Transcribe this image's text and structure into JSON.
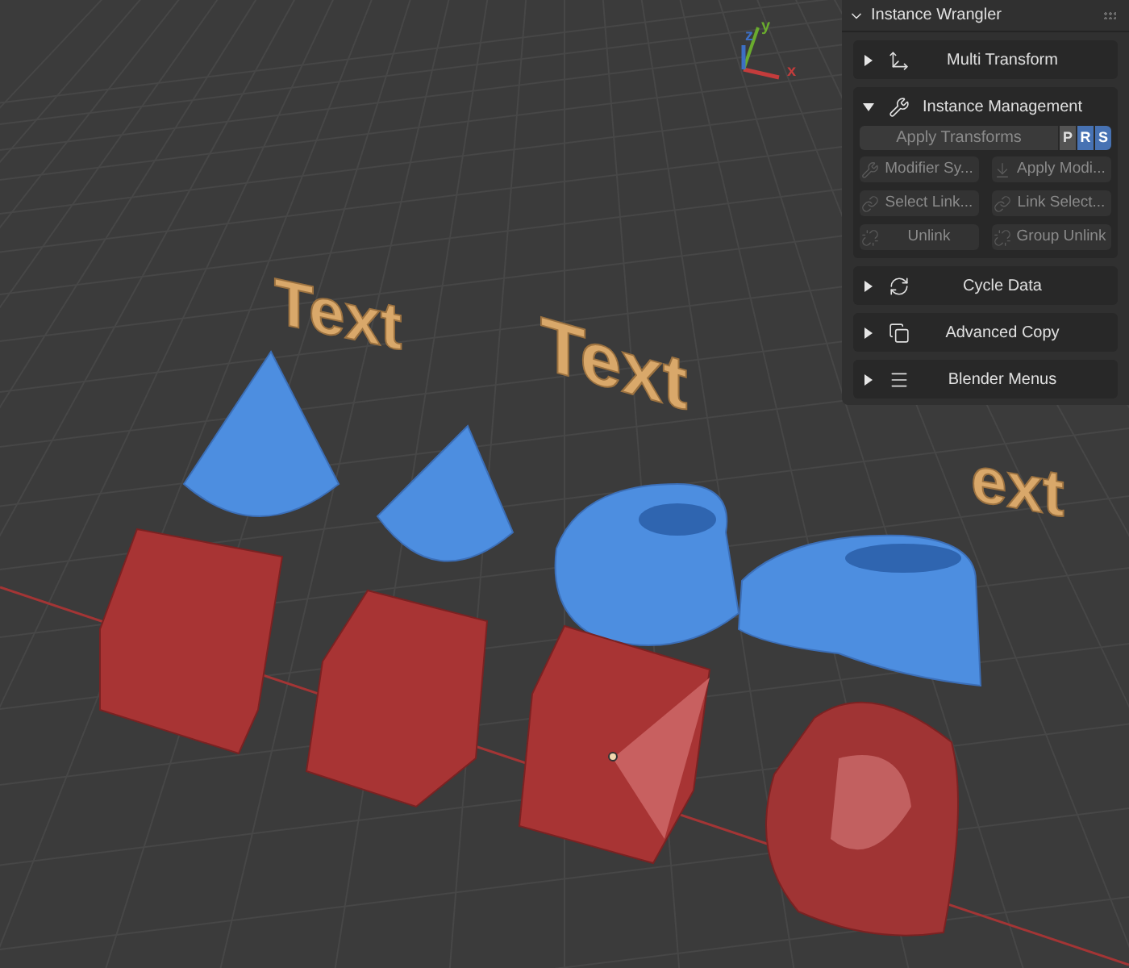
{
  "viewport": {
    "gizmo_axes": [
      "x",
      "y",
      "z"
    ],
    "scene_texts": [
      "Text",
      "Text",
      "ext"
    ]
  },
  "panel": {
    "title": "Instance Wrangler",
    "expanded": true,
    "sections": [
      {
        "title": "Multi Transform",
        "expanded": false
      },
      {
        "title": "Instance Management",
        "expanded": true,
        "apply": {
          "label": "Apply Transforms",
          "disabled": true,
          "toggles": [
            {
              "label": "P",
              "selected": false
            },
            {
              "label": "R",
              "selected": true
            },
            {
              "label": "S",
              "selected": true
            }
          ]
        },
        "buttons": [
          {
            "label": "Modifier Sy...",
            "disabled": true
          },
          {
            "label": "Apply Modi...",
            "disabled": true
          },
          {
            "label": "Select Link...",
            "disabled": true
          },
          {
            "label": "Link Select...",
            "disabled": true
          },
          {
            "label": "Unlink",
            "disabled": true
          },
          {
            "label": "Group Unlink",
            "disabled": true
          }
        ]
      },
      {
        "title": "Cycle Data",
        "expanded": false
      },
      {
        "title": "Advanced Copy",
        "expanded": false
      },
      {
        "title": "Blender Menus",
        "expanded": false
      }
    ]
  }
}
